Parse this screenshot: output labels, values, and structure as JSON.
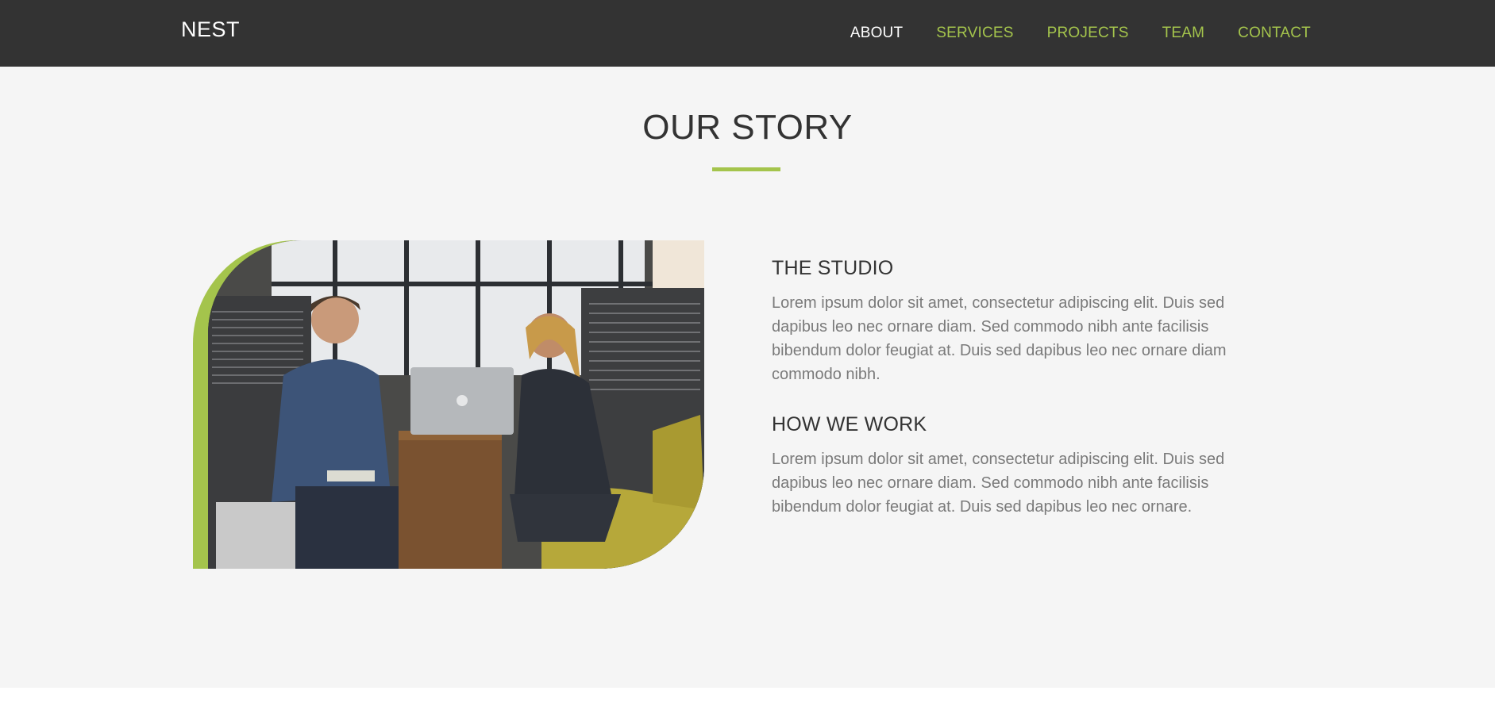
{
  "nav": {
    "brand": "NEST",
    "items": [
      {
        "label": "ABOUT"
      },
      {
        "label": "SERVICES"
      },
      {
        "label": "PROJECTS"
      },
      {
        "label": "TEAM"
      },
      {
        "label": "CONTACT"
      }
    ],
    "active_index": 0
  },
  "story": {
    "title": "OUR STORY",
    "studio": {
      "heading": "THE STUDIO",
      "text": "Lorem ipsum dolor sit amet, consectetur adipiscing elit. Duis sed dapibus leo nec ornare diam. Sed commodo nibh ante facilisis bibendum dolor feugiat at. Duis sed dapibus leo nec ornare diam commodo nibh."
    },
    "work": {
      "heading": "HOW WE WORK",
      "text": "Lorem ipsum dolor sit amet, consectetur adipiscing elit. Duis sed dapibus leo nec ornare diam. Sed commodo nibh ante facilisis bibendum dolor feugiat at. Duis sed dapibus leo nec ornare."
    },
    "photo_icon": "office-meeting-photo"
  },
  "colors": {
    "accent": "#a4c44c",
    "navbar": "#333333",
    "section_bg": "#f5f5f5",
    "heading": "#333333",
    "body_text": "#7a7a7a"
  }
}
